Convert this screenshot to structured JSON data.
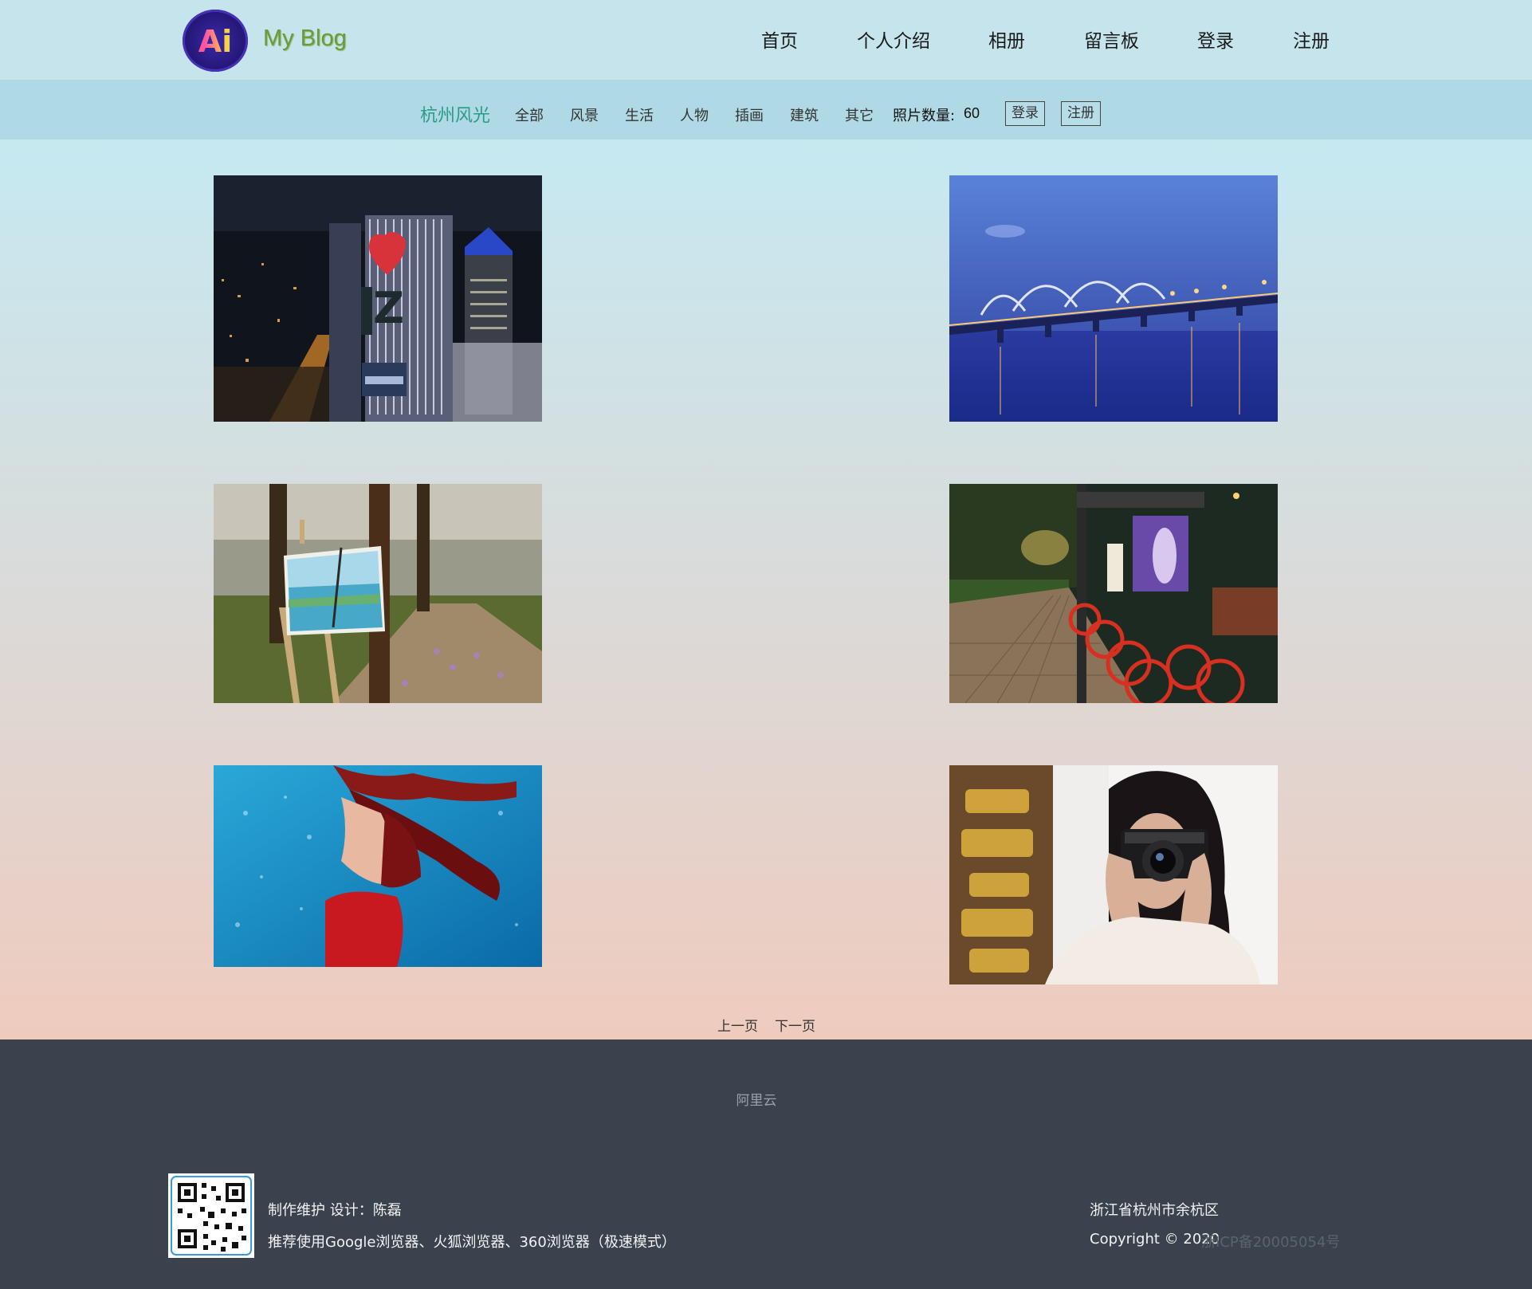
{
  "header": {
    "logo_text": "Ai",
    "brand": "My Blog",
    "nav": [
      "首页",
      "个人介绍",
      "相册",
      "留言板",
      "登录",
      "注册"
    ]
  },
  "subbar": {
    "title": "杭州风光",
    "categories": [
      "全部",
      "风景",
      "生活",
      "人物",
      "插画",
      "建筑",
      "其它"
    ],
    "count_label": "照片数量:",
    "count_value": "60",
    "login": "登录",
    "register": "注册"
  },
  "pager": {
    "prev": "上一页",
    "next": "下一页"
  },
  "footer": {
    "partner": "阿里云",
    "maintainer": "制作维护 设计：陈磊",
    "browser_tip": "推荐使用Google浏览器、火狐浏览器、360浏览器（极速模式）",
    "address": "浙江省杭州市余杭区",
    "copyright": "Copyright © 2020",
    "icp": "浙ICP备20005054号"
  },
  "colors": {
    "header_bg": "#c6e4ec",
    "subbar_bg": "#afd9e5",
    "accent": "#2a9a8a",
    "footer_bg": "#3a434d"
  }
}
